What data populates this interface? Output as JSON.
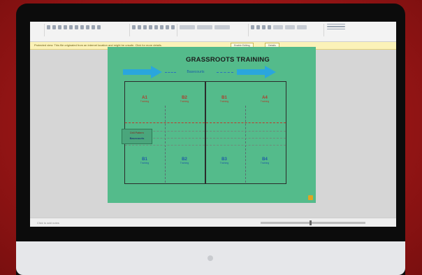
{
  "slide": {
    "title": "GRASSROOTS TRAINING",
    "direction_label": "Basecourts",
    "zones_top": [
      {
        "code": "A1",
        "sub": "Training"
      },
      {
        "code": "B2",
        "sub": "Training"
      },
      {
        "code": "B1",
        "sub": "Training"
      },
      {
        "code": "A4",
        "sub": "Training"
      }
    ],
    "zones_bottom": [
      {
        "code": "B1",
        "sub": "Training"
      },
      {
        "code": "B2",
        "sub": "Training"
      },
      {
        "code": "B3",
        "sub": "Training"
      },
      {
        "code": "B4",
        "sub": "Training"
      }
    ],
    "side_box": {
      "line1": "Drill Pattern",
      "line2": "Basecourts"
    }
  },
  "notification": {
    "message": "Protected view: This file originated from an internet location and might be unsafe. Click for more details.",
    "buttons": [
      "Enable Editing",
      "Details"
    ]
  },
  "statusbar": {
    "text": "Click to add notes"
  },
  "colors": {
    "monitor_frame": "#0c0c0c",
    "background": "#8e1414",
    "slide": "#54bb8b",
    "arrow": "#2aa6dd",
    "top_text": "#b23a2a",
    "bottom_text": "#1c5aa6"
  }
}
